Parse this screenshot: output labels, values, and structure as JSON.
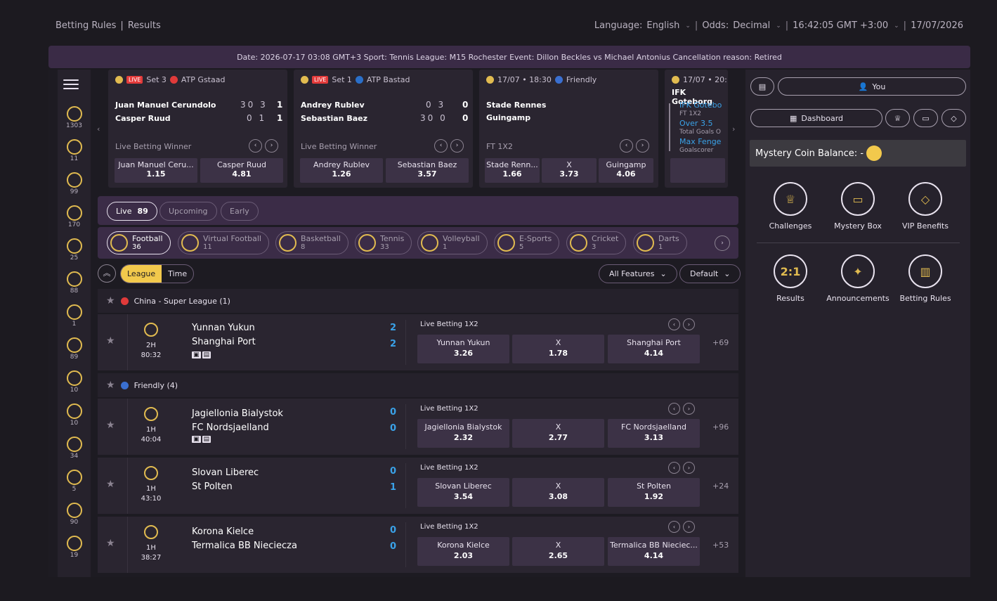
{
  "topbar": {
    "left": [
      "Betting Rules",
      "|",
      "Results"
    ],
    "language_label": "Language:",
    "language_value": "English",
    "odds_label": "Odds:",
    "odds_value": "Decimal",
    "time": "16:42:05 GMT +3:00",
    "date": "17/07/2026"
  },
  "notice": "Date: 2026-07-17 03:08 GMT+3 Sport: Tennis League: M15 Rochester Event: Dillon Beckles vs Michael Antonius Cancellation reason: Retired",
  "sidebar": {
    "items": [
      {
        "icon": "football-icon",
        "count": "1303"
      },
      {
        "icon": "virtual-football-icon",
        "count": "11"
      },
      {
        "icon": "basketball-icon",
        "count": "99"
      },
      {
        "icon": "tennis-icon",
        "count": "170"
      },
      {
        "icon": "volleyball-icon",
        "count": "25"
      },
      {
        "icon": "esports-icon",
        "count": "88"
      },
      {
        "icon": "cricket-icon",
        "count": "1"
      },
      {
        "icon": "rugby-icon",
        "count": "89"
      },
      {
        "icon": "hockey-icon",
        "count": "10"
      },
      {
        "icon": "badminton-icon",
        "count": "10"
      },
      {
        "icon": "baseball-icon",
        "count": "34"
      },
      {
        "icon": "handball-icon",
        "count": "5"
      },
      {
        "icon": "boxing-icon",
        "count": "90"
      },
      {
        "icon": "table-tennis-icon",
        "count": "19"
      }
    ]
  },
  "cards": [
    {
      "live": "LIVE",
      "set": "Set 3",
      "league": "ATP Gstaad",
      "flag_color": "#e03a3a",
      "team1": "Juan Manuel Cerundolo",
      "team2": "Casper Ruud",
      "score1": "30 3",
      "score2": "0 1",
      "sets1": "1",
      "sets2": "1",
      "market": "Live Betting Winner",
      "odds": [
        {
          "label": "Juan Manuel Ceru...",
          "value": "1.15"
        },
        {
          "label": "Casper Ruud",
          "value": "4.81"
        }
      ]
    },
    {
      "live": "LIVE",
      "set": "Set 1",
      "league": "ATP Bastad",
      "flag_color": "#2a6fc9",
      "team1": "Andrey Rublev",
      "team2": "Sebastian Baez",
      "score1": "0 3",
      "score2": "30 0",
      "sets1": "0",
      "sets2": "0",
      "market": "Live Betting Winner",
      "odds": [
        {
          "label": "Andrey Rublev",
          "value": "1.26"
        },
        {
          "label": "Sebastian Baez",
          "value": "3.57"
        }
      ]
    },
    {
      "date": "17/07 • 18:30",
      "league": "Friendly",
      "team1": "Stade Rennes",
      "team2": "Guingamp",
      "market": "FT 1X2",
      "odds": [
        {
          "label": "Stade Renn...",
          "value": "1.66"
        },
        {
          "label": "X",
          "value": "3.73"
        },
        {
          "label": "Guingamp",
          "value": "4.06"
        }
      ]
    },
    {
      "date": "17/07 • 20:",
      "team1": "IFK Goteborg",
      "lines": [
        "IFK Gotebo",
        "FT 1X2",
        "Over 3.5",
        "Total Goals O",
        "Max Fenge",
        "Goalscorer"
      ]
    }
  ],
  "tabs": [
    {
      "label": "Live",
      "count": "89"
    },
    {
      "label": "Upcoming"
    },
    {
      "label": "Early"
    }
  ],
  "sports": [
    {
      "label": "Football",
      "count": "36"
    },
    {
      "label": "Virtual Football",
      "count": "11"
    },
    {
      "label": "Basketball",
      "count": "8"
    },
    {
      "label": "Tennis",
      "count": "33"
    },
    {
      "label": "Volleyball",
      "count": "1"
    },
    {
      "label": "E-Sports",
      "count": "5"
    },
    {
      "label": "Cricket",
      "count": "3"
    },
    {
      "label": "Darts",
      "count": "1"
    }
  ],
  "filters": {
    "league": "League",
    "time": "Time",
    "features": "All Features",
    "sort": "Default"
  },
  "leagues": [
    {
      "name": "China - Super League (1)"
    },
    {
      "name": "Friendly (4)"
    }
  ],
  "matches": [
    {
      "period": "2H",
      "clock": "80:32",
      "team1": "Yunnan Yukun",
      "team2": "Shanghai Port",
      "score1": "2",
      "score2": "2",
      "tv": true,
      "market": "Live Betting 1X2",
      "odds": [
        {
          "label": "Yunnan Yukun",
          "value": "3.26"
        },
        {
          "label": "X",
          "value": "1.78"
        },
        {
          "label": "Shanghai Port",
          "value": "4.14"
        }
      ],
      "more": "+69"
    },
    {
      "period": "1H",
      "clock": "40:04",
      "team1": "Jagiellonia Bialystok",
      "team2": "FC Nordsjaelland",
      "score1": "0",
      "score2": "0",
      "tv": true,
      "market": "Live Betting 1X2",
      "odds": [
        {
          "label": "Jagiellonia Bialystok",
          "value": "2.32"
        },
        {
          "label": "X",
          "value": "2.77"
        },
        {
          "label": "FC Nordsjaelland",
          "value": "3.13"
        }
      ],
      "more": "+96"
    },
    {
      "period": "1H",
      "clock": "43:10",
      "team1": "Slovan Liberec",
      "team2": "St Polten",
      "score1": "0",
      "score2": "1",
      "market": "Live Betting 1X2",
      "odds": [
        {
          "label": "Slovan Liberec",
          "value": "3.54"
        },
        {
          "label": "X",
          "value": "3.08"
        },
        {
          "label": "St Polten",
          "value": "1.92"
        }
      ],
      "more": "+24"
    },
    {
      "period": "1H",
      "clock": "38:27",
      "team1": "Korona Kielce",
      "team2": "Termalica BB Nieciecza",
      "score1": "0",
      "score2": "0",
      "market": "Live Betting 1X2",
      "odds": [
        {
          "label": "Korona Kielce",
          "value": "2.03"
        },
        {
          "label": "X",
          "value": "2.65"
        },
        {
          "label": "Termalica BB Nieciec...",
          "value": "4.14"
        }
      ],
      "more": "+53"
    }
  ],
  "right": {
    "you": "You",
    "dashboard": "Dashboard",
    "coin_label": "Mystery Coin Balance: -",
    "features": [
      "Challenges",
      "Mystery Box",
      "VIP Benefits",
      "Results",
      "Announcements",
      "Betting Rules"
    ],
    "results_glyph": "2:1"
  },
  "colors": {
    "accent": "#f2c94c",
    "live": "#e33b3b",
    "score": "#3aa2e8",
    "panel": "#2a2530"
  }
}
